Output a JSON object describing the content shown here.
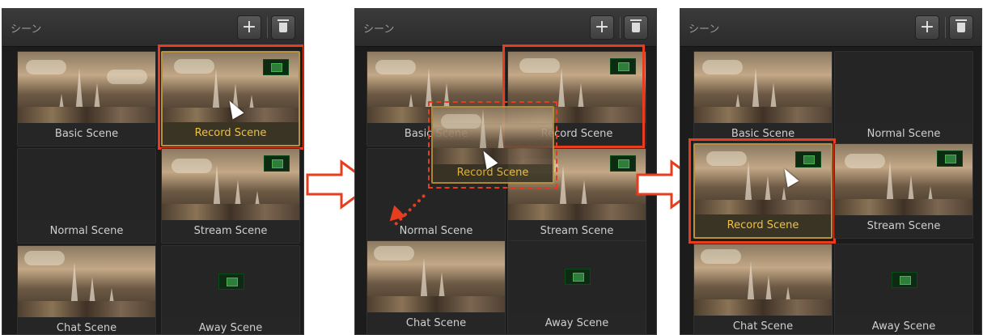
{
  "scenes_panel_title": "シーン",
  "add_button": "+",
  "panels": [
    {
      "tiles": [
        {
          "label": "Basic Scene"
        },
        {
          "label": "Record Scene"
        },
        {
          "label": "Normal Scene"
        },
        {
          "label": "Stream Scene"
        },
        {
          "label": "Chat Scene"
        },
        {
          "label": "Away Scene"
        }
      ]
    },
    {
      "tiles": [
        {
          "label": "Basic Scene"
        },
        {
          "label": "Record Scene"
        },
        {
          "label": "Normal Scene"
        },
        {
          "label": "Stream Scene"
        },
        {
          "label": "Chat Scene"
        },
        {
          "label": "Away Scene"
        }
      ],
      "dragging_label": "Record Scene"
    },
    {
      "tiles": [
        {
          "label": "Basic Scene"
        },
        {
          "label": "Normal Scene"
        },
        {
          "label": "Record Scene"
        },
        {
          "label": "Stream Scene"
        },
        {
          "label": "Chat Scene"
        },
        {
          "label": "Away Scene"
        }
      ]
    }
  ],
  "colors": {
    "highlight": "#e83c1e",
    "selected_text": "#f0c040"
  }
}
